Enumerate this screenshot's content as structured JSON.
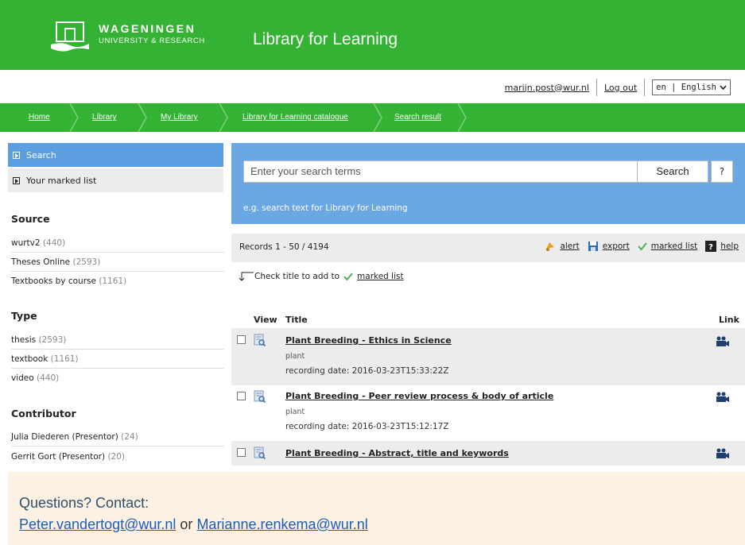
{
  "header": {
    "brand_name": "WAGENINGEN",
    "brand_sub": "UNIVERSITY & RESEARCH",
    "site_title": "Library for Learning",
    "brand_color": "#34b233"
  },
  "userbar": {
    "email": "marijn.post@wur.nl",
    "logout": "Log out",
    "language": "en | English"
  },
  "breadcrumb": [
    "Home",
    "Library",
    "My Library",
    "Library for Learning catalogue",
    "Search result"
  ],
  "sidebar": {
    "menu": [
      {
        "label": "Search",
        "active": true
      },
      {
        "label": "Your marked list",
        "active": false
      }
    ],
    "facets": [
      {
        "title": "Source",
        "items": [
          {
            "label": "wurtv2",
            "count": "(440)"
          },
          {
            "label": "Theses Online",
            "count": "(2593)"
          },
          {
            "label": "Textbooks by course",
            "count": "(1161)"
          }
        ]
      },
      {
        "title": "Type",
        "items": [
          {
            "label": "thesis",
            "count": "(2593)"
          },
          {
            "label": "textbook",
            "count": "(1161)"
          },
          {
            "label": "video",
            "count": "(440)"
          }
        ]
      },
      {
        "title": "Contributor",
        "items": [
          {
            "label": "Julia Diederen (Presentor)",
            "count": "(24)"
          },
          {
            "label": "Gerrit Gort (Presentor)",
            "count": "(20)"
          }
        ]
      }
    ]
  },
  "search": {
    "placeholder": "Enter your search terms",
    "button": "Search",
    "help": "?",
    "hint": "e.g. search text for Library for Learning"
  },
  "records": {
    "summary": "Records 1 - 50 / 4194",
    "actions": {
      "alert": "alert",
      "export": "export",
      "marked_list": "marked list",
      "help": "help"
    },
    "check_hint": "Check title to add to",
    "check_hint_link": "marked list"
  },
  "table": {
    "headers": {
      "view": "View",
      "title": "Title",
      "link": "Link"
    },
    "rows": [
      {
        "title": "Plant Breeding - Ethics in Science",
        "subject": "plant",
        "date": "recording date: 2016-03-23T15:33:22Z"
      },
      {
        "title": "Plant Breeding - Peer review process & body of article",
        "subject": "plant",
        "date": "recording date: 2016-03-23T15:12:17Z"
      },
      {
        "title": "Plant Breeding - Abstract, title and keywords",
        "subject": "",
        "date": ""
      }
    ]
  },
  "footer": {
    "line1": "Questions? Contact:",
    "email1": "Peter.vandertogt@wur.nl",
    "or": "or",
    "email2": "Marianne.renkema@wur.nl"
  }
}
